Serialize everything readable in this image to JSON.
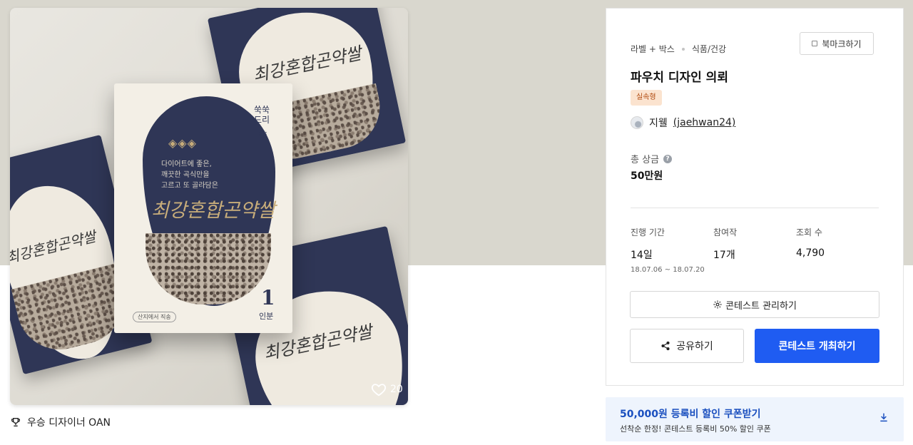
{
  "colors": {
    "primary": "#1f5cf2",
    "hero_background": "#d9d7ce",
    "badge_bg": "#fbe3cf",
    "badge_text": "#b04a0f",
    "coupon_bg": "#eef4fd",
    "coupon_title": "#1a4fbf",
    "package_navy": "#2f3656",
    "package_gold": "#c8ad7a"
  },
  "product_image": {
    "brand": "쑥쑥\n드리",
    "package_title": "최강혼합곤약쌀",
    "package_desc": "다이어트에 좋은,\n깨끗한 곡식만을\n고르고 또 골라담은",
    "number": "1",
    "number_sub": "인분",
    "seal_text": "산지에서 직송",
    "likes": "20"
  },
  "winner": {
    "icon": "trophy-icon",
    "text": "우승 디자이너 OAN"
  },
  "panel": {
    "category_main": "라벨 + 박스",
    "category_sub": "식품/건강",
    "bookmark_label": "북마크하기",
    "title": "파우치 디자인 의뢰",
    "badge": "실속형",
    "author_name": "지웰",
    "author_handle": "(jaehwan24)",
    "prize_label": "총 상금",
    "prize_help_icon": "?",
    "prize_value": "50만원",
    "stats": [
      {
        "label": "진행 기간",
        "value": "14일",
        "sub": "18.07.06 ~ 18.07.20"
      },
      {
        "label": "참여작",
        "value": "17개",
        "sub": ""
      },
      {
        "label": "조회 수",
        "value": "4,790",
        "sub": ""
      }
    ],
    "manage_label": "콘테스트 관리하기",
    "share_label": "공유하기",
    "host_label": "콘테스트 개최하기"
  },
  "coupon": {
    "title": "50,000원 등록비 할인 쿠폰받기",
    "subtitle": "선착순 한정! 콘테스트 등록비 50% 할인 쿠폰",
    "icon": "download-icon"
  }
}
